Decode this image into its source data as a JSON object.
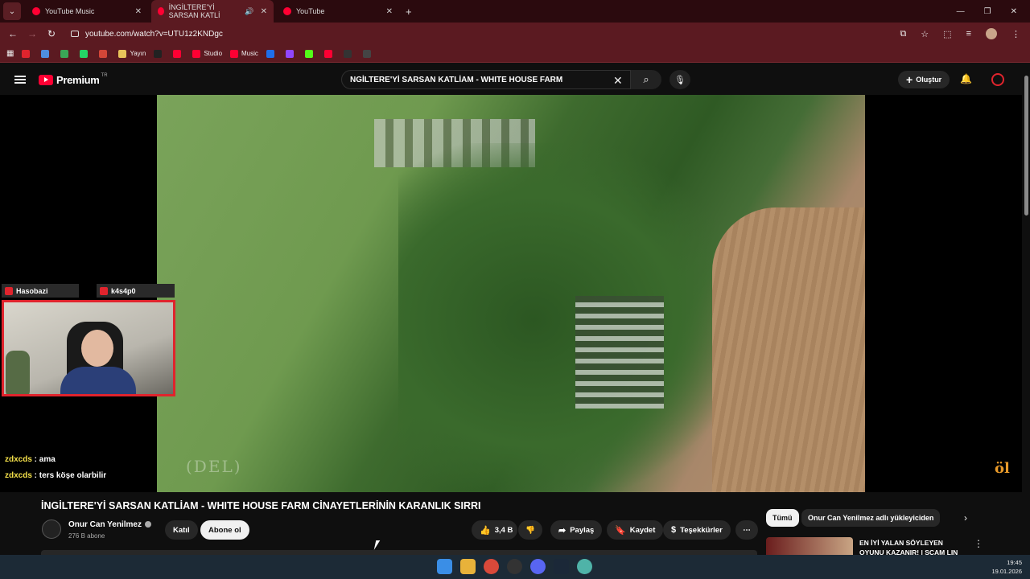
{
  "browser": {
    "tabs": [
      {
        "label": "YouTube Music",
        "active": false
      },
      {
        "label": "İNGİLTERE'Yİ SARSAN KATLİ",
        "active": true
      },
      {
        "label": "YouTube",
        "active": false
      }
    ],
    "url": "youtube.com/watch?v=UTU1z2KNDgc",
    "bookmarks": [
      {
        "label": "",
        "color": "#e0242d"
      },
      {
        "label": "",
        "color": "#4f8de0"
      },
      {
        "label": "",
        "color": "#3aa757"
      },
      {
        "label": "",
        "color": "#25d366"
      },
      {
        "label": "",
        "color": "#d44638"
      },
      {
        "label": "Yayın",
        "color": "#e8c35a"
      },
      {
        "label": "",
        "color": "#222222"
      },
      {
        "label": "",
        "color": "#ff0033"
      },
      {
        "label": "Studio",
        "color": "#ff0033"
      },
      {
        "label": "Music",
        "color": "#ff0033"
      },
      {
        "label": "",
        "color": "#1f6feb"
      },
      {
        "label": "",
        "color": "#9146ff"
      },
      {
        "label": "",
        "color": "#53fc18"
      },
      {
        "label": "",
        "color": "#ff0033"
      },
      {
        "label": "",
        "color": "#333333"
      },
      {
        "label": "",
        "color": "#444444"
      }
    ]
  },
  "youtube": {
    "brand": "Premium",
    "region": "TR",
    "search_query": "NGİLTERE'Yİ SARSAN KATLİAM - WHITE HOUSE FARM",
    "create_label": "Oluştur"
  },
  "overlay": {
    "cam_label_left": "Hasobazi",
    "cam_label_right": "k4s4p0",
    "chat": [
      {
        "user": "zdxcds",
        "message": " : ama"
      },
      {
        "user": "zdxcds",
        "message": " : ters köşe olarbilir"
      }
    ],
    "video_watermark": "(DEL)",
    "corner_logo": "öl"
  },
  "video": {
    "title": "İNGİLTERE'Yİ SARSAN KATLİAM - WHITE HOUSE FARM CİNAYETLERİNİN KARANLIK SIRRI",
    "channel_name": "Onur Can Yenilmez",
    "subscribers": "276 B abone",
    "join_label": "Katıl",
    "subscribe_label": "Abone ol",
    "likes": "3,4 B",
    "share_label": "Paylaş",
    "save_label": "Kaydet",
    "thanks_label": "Teşekkürler"
  },
  "sidebar": {
    "chips": [
      {
        "label": "Tümü",
        "selected": true
      },
      {
        "label": "Onur Can Yenilmez adlı yükleyiciden",
        "selected": false
      }
    ],
    "recommendation_title": "EN İYİ YALAN SÖYLEYEN OYUNU KAZANIR! | SCAM LIN"
  },
  "taskbar": {
    "time": "19:45",
    "date": "19.01.2026"
  },
  "colors": {
    "accent": "#e0242d",
    "chrome_frame": "#5b1a21",
    "yt_red": "#ff0033"
  }
}
